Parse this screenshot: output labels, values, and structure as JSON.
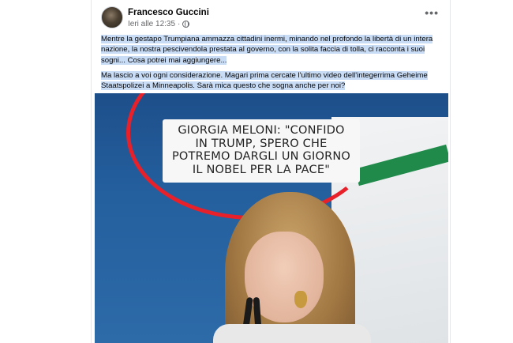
{
  "post": {
    "author": "Francesco Guccini",
    "time": "Ieri alle 12:35",
    "visibility_icon": "globe-icon",
    "more_icon": "more-options-icon",
    "more_label": "•••",
    "paragraphs": [
      "Mentre la gestapo Trumpiana ammazza cittadini inermi, minando nel profondo la libertà di un intera nazione, la nostra pescivendola prestata al governo, con la solita faccia di tolla, ci racconta i suoi sogni... Cosa potrei mai aggiungere...",
      "Ma lascio a voi ogni considerazione. Magari prima cercate l'ultimo video dell'integerrima Geheime Staatspolizei a Minneapolis. Sarà mica questo che sogna anche per noi?"
    ],
    "image": {
      "caption_lines": [
        "GIORGIA MELONI: \"CONFIDO",
        "IN TRUMP, SPERO CHE",
        "POTREMO DARGLI UN GIORNO",
        "IL NOBEL PER LA PACE\""
      ]
    }
  },
  "colors": {
    "highlight": "#c9dcf5",
    "text": "#050505",
    "meta": "#65676b"
  }
}
